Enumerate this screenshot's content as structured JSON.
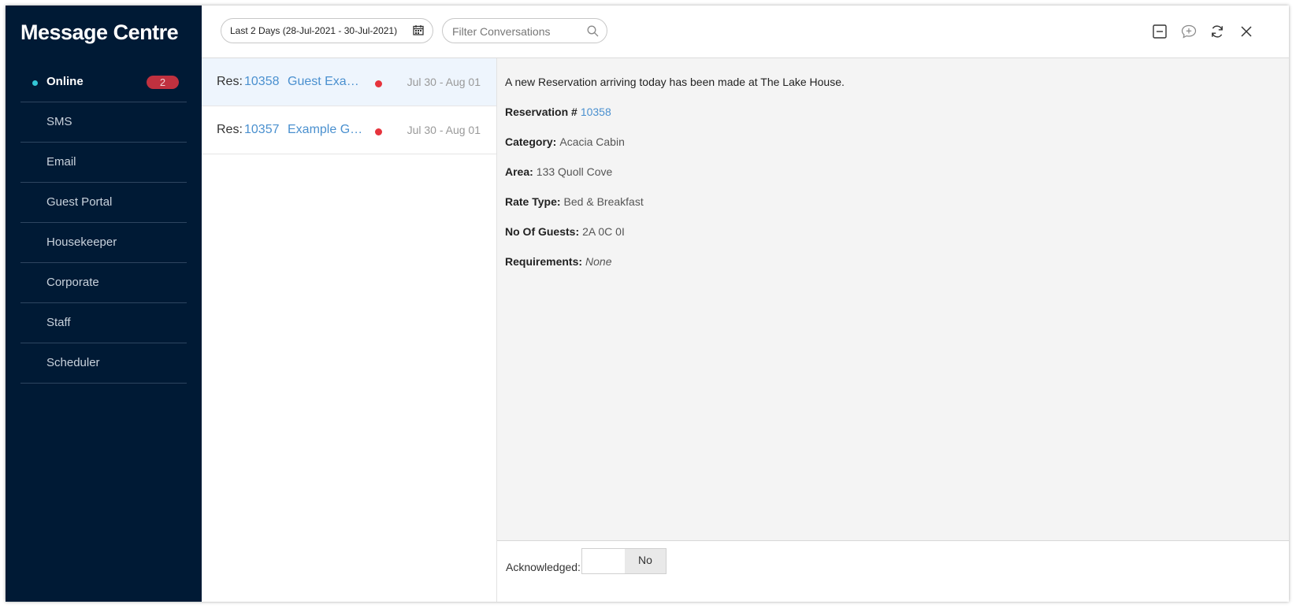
{
  "app": {
    "title": "Message Centre"
  },
  "sidebar": {
    "items": [
      {
        "label": "Online",
        "badge": "2",
        "active": true
      },
      {
        "label": "SMS"
      },
      {
        "label": "Email"
      },
      {
        "label": "Guest Portal"
      },
      {
        "label": "Housekeeper"
      },
      {
        "label": "Corporate"
      },
      {
        "label": "Staff"
      },
      {
        "label": "Scheduler"
      }
    ]
  },
  "toolbar": {
    "date_range": "Last 2 Days (28-Jul-2021 - 30-Jul-2021)",
    "filter_placeholder": "Filter Conversations",
    "icons": [
      "minus-square-icon",
      "chat-add-icon",
      "refresh-icon",
      "close-icon"
    ]
  },
  "conversations": [
    {
      "prefix": "Res:",
      "number": "10358",
      "guest": "Guest Example",
      "dates": "Jul 30 - Aug 01",
      "unread": true,
      "selected": true
    },
    {
      "prefix": "Res:",
      "number": "10357",
      "guest": "Example Guest",
      "dates": "Jul 30 - Aug 01",
      "unread": true,
      "selected": false
    }
  ],
  "detail": {
    "intro": "A new Reservation arriving today has been made at The Lake House.",
    "fields": {
      "reservation": {
        "label": "Reservation #",
        "value": "10358"
      },
      "category": {
        "label": "Category:",
        "value": "Acacia Cabin"
      },
      "area": {
        "label": "Area:",
        "value": "133 Quoll Cove"
      },
      "rate_type": {
        "label": "Rate Type:",
        "value": "Bed & Breakfast"
      },
      "guests": {
        "label": "No Of Guests:",
        "value": "2A 0C 0I"
      },
      "requirements": {
        "label": "Requirements:",
        "value": "None"
      }
    }
  },
  "acknowledged": {
    "label": "Acknowledged:",
    "value": "No"
  },
  "colors": {
    "sidebar_bg": "#001a35",
    "accent": "#4a90cf",
    "badge": "#c0313f",
    "unread_dot": "#e6343d",
    "online_dot": "#33c6d6"
  }
}
